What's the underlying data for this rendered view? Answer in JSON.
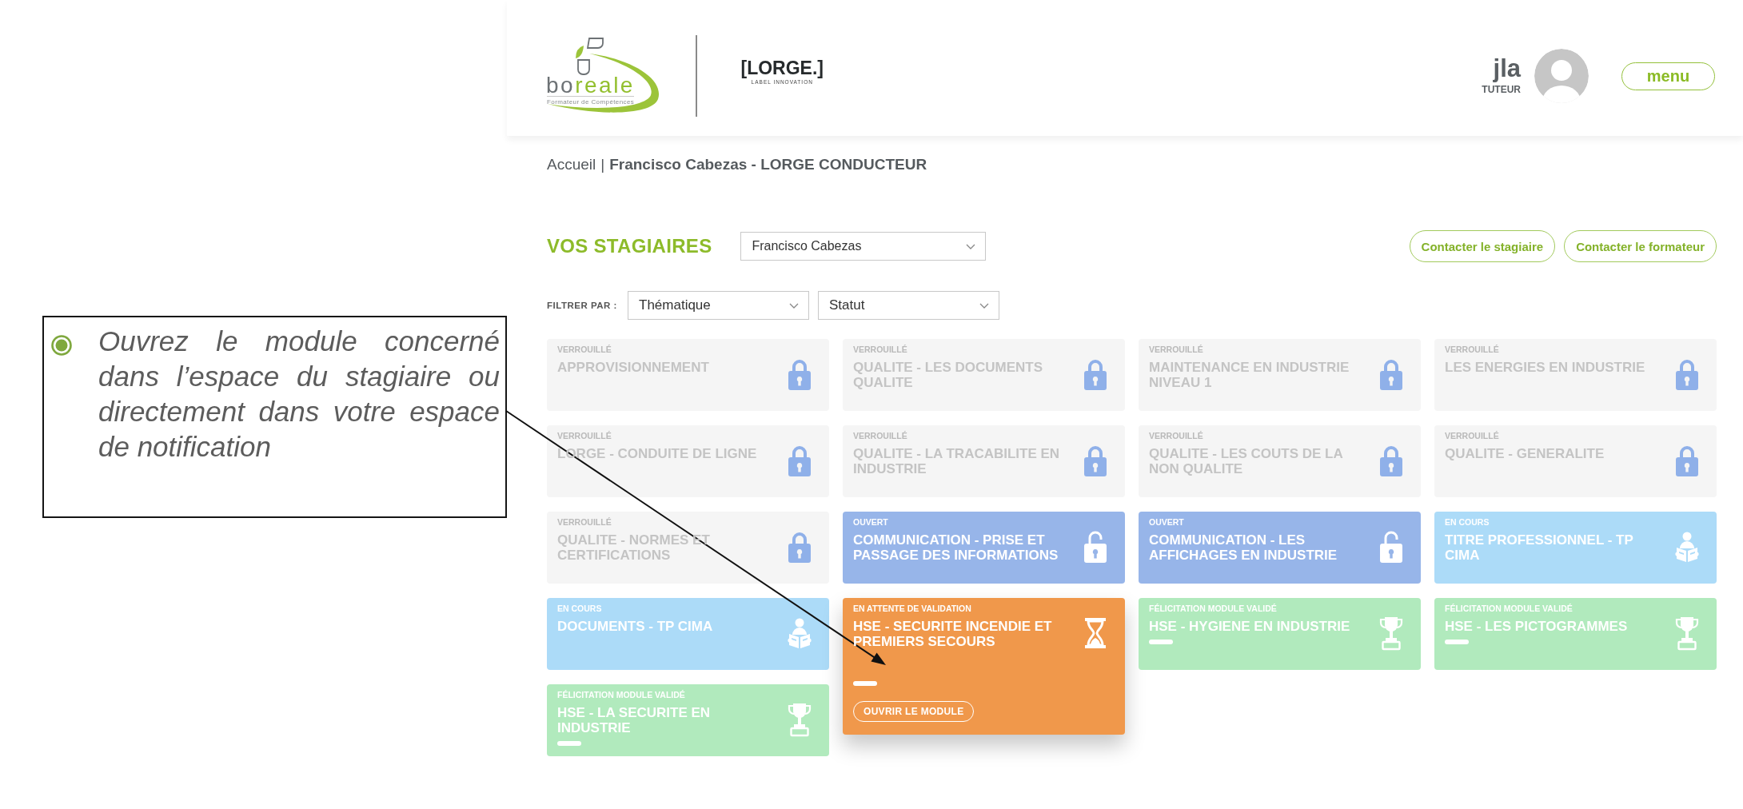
{
  "callout": {
    "text": "Ouvrez le module concerné dans l’espace du stagiaire ou directement dans votre espace de notification"
  },
  "header": {
    "brand": {
      "name": [
        {
          "text": "bo",
          "color": "#6d7275"
        },
        {
          "text": "reale",
          "color": "#93bf2e"
        }
      ],
      "tagline": "Formateur de Compétences"
    },
    "partner": {
      "name": "[LORGE.]",
      "tagline": "LABEL INNOVATION"
    },
    "user": {
      "name": "jla",
      "role": "TUTEUR"
    },
    "menu_button": "menu"
  },
  "breadcrumb": {
    "home": "Accueil",
    "separator": "|",
    "current": "Francisco Cabezas - LORGE CONDUCTEUR"
  },
  "trainees": {
    "title": "VOS STAGIAIRES",
    "select": {
      "value": "Francisco Cabezas"
    },
    "buttons": [
      "Contacter le stagiaire",
      "Contacter le formateur"
    ]
  },
  "filters": {
    "label": "FILTRER PAR :",
    "selects": [
      {
        "value": "Thématique"
      },
      {
        "value": "Statut"
      }
    ]
  },
  "modules": [
    {
      "kind": "locked",
      "status": "VERROUILLÉ",
      "title": "APPROVISIONNEMENT"
    },
    {
      "kind": "locked",
      "status": "VERROUILLÉ",
      "title": "QUALITE - LES DOCUMENTS QUALITE"
    },
    {
      "kind": "locked",
      "status": "VERROUILLÉ",
      "title": "MAINTENANCE EN INDUSTRIE NIVEAU 1"
    },
    {
      "kind": "locked",
      "status": "VERROUILLÉ",
      "title": "LES ENERGIES EN INDUSTRIE"
    },
    {
      "kind": "locked",
      "status": "VERROUILLÉ",
      "title": "LORGE - CONDUITE DE LIGNE"
    },
    {
      "kind": "locked",
      "status": "VERROUILLÉ",
      "title": "QUALITE - LA TRACABILITE EN INDUSTRIE"
    },
    {
      "kind": "locked",
      "status": "VERROUILLÉ",
      "title": "QUALITE - LES COUTS DE LA NON QUALITE"
    },
    {
      "kind": "locked",
      "status": "VERROUILLÉ",
      "title": "QUALITE - GENERALITE"
    },
    {
      "kind": "locked",
      "status": "VERROUILLÉ",
      "title": "QUALITE - NORMES ET CERTIFICATIONS"
    },
    {
      "kind": "open",
      "status": "OUVERT",
      "title": "COMMUNICATION - PRISE ET PASSAGE DES INFORMATIONS"
    },
    {
      "kind": "open",
      "status": "OUVERT",
      "title": "COMMUNICATION - LES AFFICHAGES EN INDUSTRIE"
    },
    {
      "kind": "ongoing",
      "status": "EN COURS",
      "title": "TITRE PROFESSIONNEL - TP CIMA"
    },
    {
      "kind": "ongoing",
      "status": "EN COURS",
      "title": "DOCUMENTS - TP CIMA"
    },
    {
      "kind": "pending",
      "status": "EN ATTENTE DE VALIDATION",
      "title": "HSE - SECURITE INCENDIE ET PREMIERS SECOURS",
      "action": "OUVRIR LE MODULE"
    },
    {
      "kind": "validated",
      "status": "FÉLICITATION MODULE VALIDÉ",
      "title": "HSE - HYGIENE EN INDUSTRIE"
    },
    {
      "kind": "validated",
      "status": "FÉLICITATION MODULE VALIDÉ",
      "title": "HSE - LES PICTOGRAMMES"
    },
    {
      "kind": "validated",
      "status": "FÉLICITATION MODULE VALIDÉ",
      "title": "HSE - LA SECURITE EN INDUSTRIE"
    }
  ]
}
